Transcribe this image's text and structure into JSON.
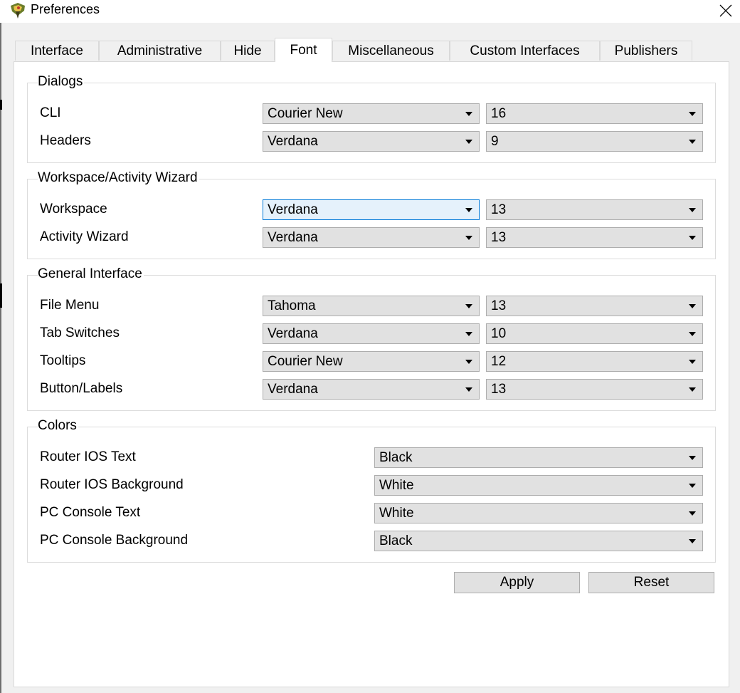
{
  "window": {
    "title": "Preferences"
  },
  "tabs": [
    {
      "label": "Interface"
    },
    {
      "label": "Administrative"
    },
    {
      "label": "Hide"
    },
    {
      "label": "Font"
    },
    {
      "label": "Miscellaneous"
    },
    {
      "label": "Custom Interfaces"
    },
    {
      "label": "Publishers"
    }
  ],
  "active_tab": "Font",
  "dialogs": {
    "title": "Dialogs",
    "rows": [
      {
        "label": "CLI",
        "font": "Courier New",
        "size": "16"
      },
      {
        "label": "Headers",
        "font": "Verdana",
        "size": "9"
      }
    ]
  },
  "workspace": {
    "title": "Workspace/Activity Wizard",
    "rows": [
      {
        "label": "Workspace",
        "font": "Verdana",
        "size": "13"
      },
      {
        "label": "Activity Wizard",
        "font": "Verdana",
        "size": "13"
      }
    ]
  },
  "general": {
    "title": "General Interface",
    "rows": [
      {
        "label": "File Menu",
        "font": "Tahoma",
        "size": "13"
      },
      {
        "label": "Tab Switches",
        "font": "Verdana",
        "size": "10"
      },
      {
        "label": "Tooltips",
        "font": "Courier New",
        "size": "12"
      },
      {
        "label": "Button/Labels",
        "font": "Verdana",
        "size": "13"
      }
    ]
  },
  "colors": {
    "title": "Colors",
    "rows": [
      {
        "label": "Router IOS Text",
        "value": "Black"
      },
      {
        "label": "Router IOS Background",
        "value": "White"
      },
      {
        "label": "PC Console Text",
        "value": "White"
      },
      {
        "label": "PC Console Background",
        "value": "Black"
      }
    ]
  },
  "buttons": {
    "apply": "Apply",
    "reset": "Reset"
  },
  "icons": {
    "app": "packet-tracer-icon",
    "close": "close-icon"
  }
}
